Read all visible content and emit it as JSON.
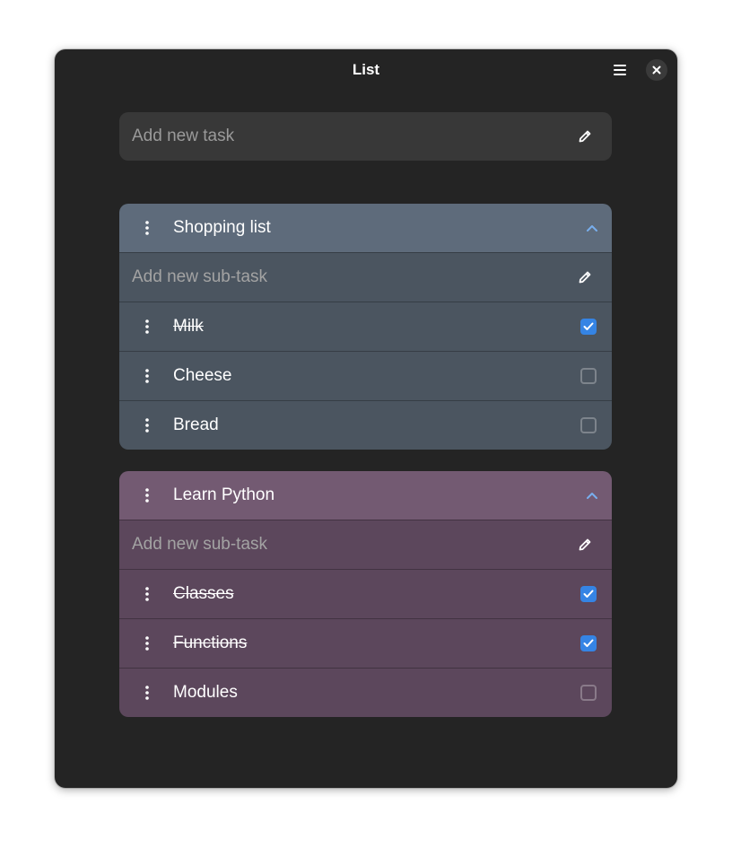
{
  "window": {
    "title": "List"
  },
  "add_task": {
    "placeholder": "Add new task"
  },
  "groups": [
    {
      "title": "Shopping list",
      "header_color": "#5e6b7b",
      "body_color": "#4b5560",
      "subtask_placeholder": "Add new sub-task",
      "items": [
        {
          "label": "Milk",
          "done": true
        },
        {
          "label": "Cheese",
          "done": false
        },
        {
          "label": "Bread",
          "done": false
        }
      ]
    },
    {
      "title": "Learn Python",
      "header_color": "#735a72",
      "body_color": "#5c475c",
      "subtask_placeholder": "Add new sub-task",
      "items": [
        {
          "label": "Classes",
          "done": true
        },
        {
          "label": "Functions",
          "done": true
        },
        {
          "label": "Modules",
          "done": false
        }
      ]
    }
  ],
  "colors": {
    "window_bg": "#242424",
    "accent": "#3584e4",
    "chevron": "#78aeed"
  },
  "icons": {
    "menu": "hamburger-menu-icon",
    "close": "close-icon",
    "edit": "pencil-icon",
    "drag": "vertical-dots-icon",
    "collapse": "chevron-up-icon",
    "check": "checkmark-icon"
  }
}
